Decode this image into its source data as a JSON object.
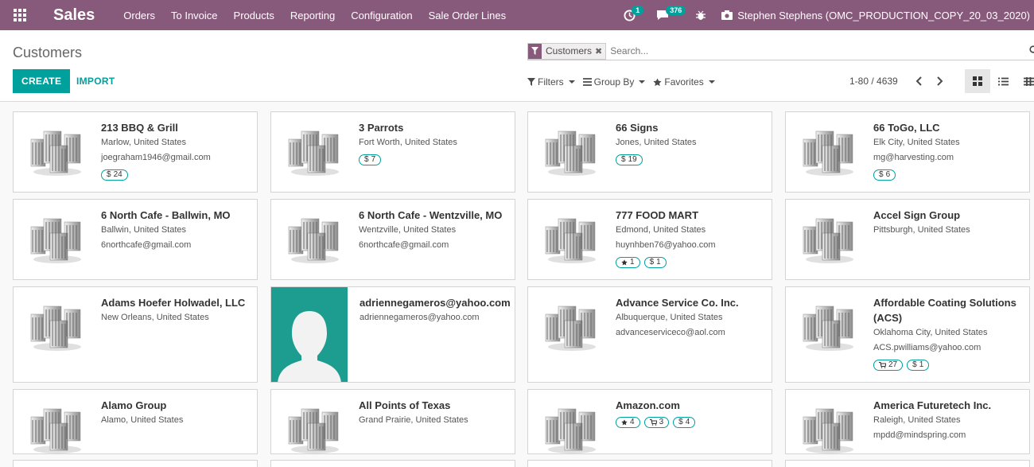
{
  "navbar": {
    "app_name": "Sales",
    "menu": [
      "Orders",
      "To Invoice",
      "Products",
      "Reporting",
      "Configuration",
      "Sale Order Lines"
    ],
    "activity_count": "1",
    "message_count": "376",
    "user": "Stephen Stephens (OMC_PRODUCTION_COPY_20_03_2020)"
  },
  "control": {
    "title": "Customers",
    "create_label": "CREATE",
    "import_label": "IMPORT",
    "facet_label": "Customers",
    "search_placeholder": "Search...",
    "filters_label": "Filters",
    "groupby_label": "Group By",
    "favorites_label": "Favorites",
    "pager": "1-80 / 4639"
  },
  "cards": [
    {
      "name": "213 BBQ & Grill",
      "location": "Marlow, United States",
      "email": "joegraham1946@gmail.com",
      "tags": [
        {
          "icon": "dollar",
          "value": "24"
        }
      ]
    },
    {
      "name": "3 Parrots",
      "location": "Fort Worth, United States",
      "email": "",
      "tags": [
        {
          "icon": "dollar",
          "value": "7"
        }
      ]
    },
    {
      "name": "66 Signs",
      "location": "Jones, United States",
      "email": "",
      "tags": [
        {
          "icon": "dollar",
          "value": "19"
        }
      ]
    },
    {
      "name": "66 ToGo, LLC",
      "location": "Elk City, United States",
      "email": "mg@harvesting.com",
      "tags": [
        {
          "icon": "dollar",
          "value": "6"
        }
      ]
    },
    {
      "name": "6 North Cafe - Ballwin, MO",
      "location": "Ballwin, United States",
      "email": "6northcafe@gmail.com",
      "tags": []
    },
    {
      "name": "6 North Cafe - Wentzville, MO",
      "location": "Wentzville, United States",
      "email": "6northcafe@gmail.com",
      "tags": []
    },
    {
      "name": "777 FOOD MART",
      "location": "Edmond, United States",
      "email": "huynhben76@yahoo.com",
      "tags": [
        {
          "icon": "star",
          "value": "1"
        },
        {
          "icon": "dollar",
          "value": "1"
        }
      ]
    },
    {
      "name": "Accel Sign Group",
      "location": "Pittsburgh, United States",
      "email": "",
      "tags": []
    },
    {
      "name": "Adams Hoefer Holwadel, LLC",
      "location": "New Orleans, United States",
      "email": "",
      "tags": []
    },
    {
      "name": "adriennegameros@yahoo.com",
      "location": "adriennegameros@yahoo.com",
      "email": "",
      "tags": [],
      "avatar": true
    },
    {
      "name": "Advance Service Co. Inc.",
      "location": "Albuquerque, United States",
      "email": "advanceserviceco@aol.com",
      "tags": []
    },
    {
      "name": "Affordable Coating Solutions (ACS)",
      "location": "Oklahoma City, United States",
      "email": "ACS.pwilliams@yahoo.com",
      "tags": [
        {
          "icon": "cart",
          "value": "27"
        },
        {
          "icon": "dollar",
          "value": "1"
        }
      ]
    },
    {
      "name": "Alamo Group",
      "location": "Alamo, United States",
      "email": "",
      "tags": []
    },
    {
      "name": "All Points of Texas",
      "location": "Grand Prairie, United States",
      "email": "",
      "tags": []
    },
    {
      "name": "Amazon.com",
      "location": "",
      "email": "",
      "tags": [
        {
          "icon": "star",
          "value": "4"
        },
        {
          "icon": "cart",
          "value": "3"
        },
        {
          "icon": "dollar",
          "value": "4"
        }
      ]
    },
    {
      "name": "America Futuretech Inc.",
      "location": "Raleigh, United States",
      "email": "mpdd@mindspring.com",
      "tags": []
    }
  ]
}
